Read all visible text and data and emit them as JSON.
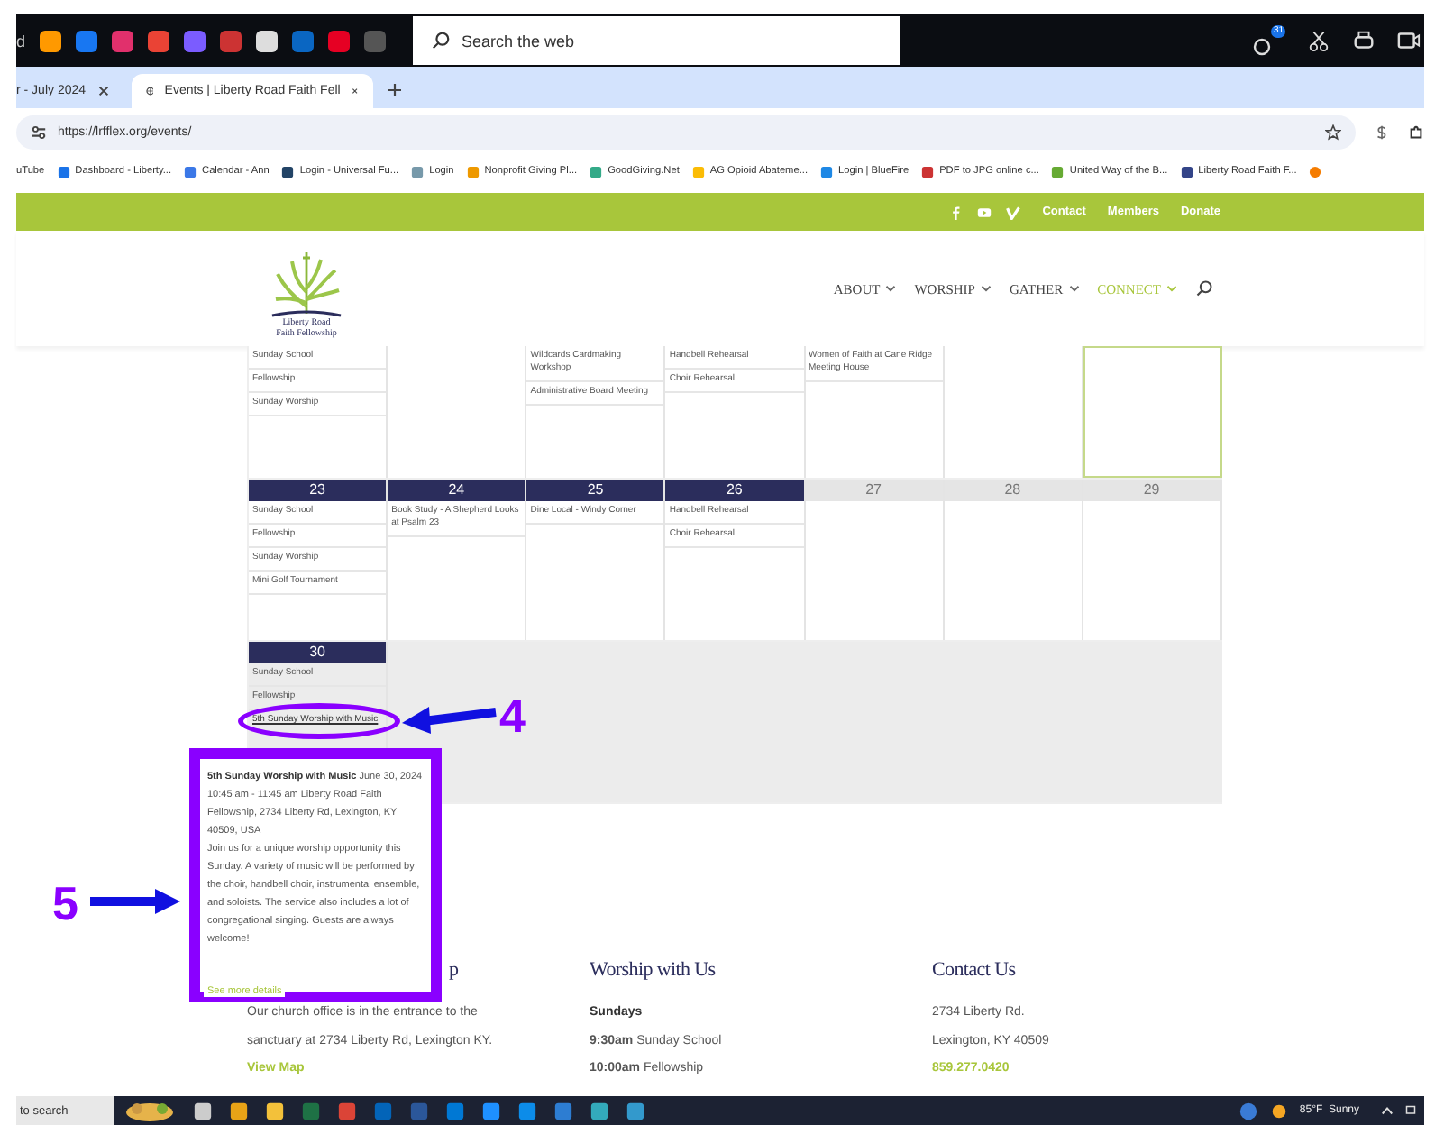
{
  "top_bar": {
    "left_fragment": "d",
    "search_placeholder": "Search the web",
    "notification_count": "31"
  },
  "tabs": [
    {
      "label": "r - July 2024",
      "selected": false
    },
    {
      "label": "Events | Liberty Road Faith Fell",
      "selected": true
    }
  ],
  "address_bar": {
    "url": "https://lrfflex.org/events/"
  },
  "bookmarks": [
    "uTube",
    "Dashboard - Liberty...",
    "Calendar - Ann",
    "Login - Universal Fu...",
    "Login",
    "Nonprofit Giving Pl...",
    "GoodGiving.Net",
    "AG Opioid Abateme...",
    "Login | BlueFire",
    "PDF to JPG online c...",
    "United Way of the B...",
    "Liberty Road Faith F..."
  ],
  "site_top_links": [
    "Contact",
    "Members",
    "Donate"
  ],
  "logo_text": [
    "Liberty Road",
    "Faith Fellowship"
  ],
  "nav": [
    {
      "label": "ABOUT",
      "selected": false
    },
    {
      "label": "WORSHIP",
      "selected": false
    },
    {
      "label": "GATHER",
      "selected": false
    },
    {
      "label": "CONNECT",
      "selected": true
    }
  ],
  "calendar": {
    "weeks": [
      {
        "days": [
          {
            "today": false,
            "events": [
              {
                "title": "Sunday School",
                "kind": "event"
              },
              {
                "title": "Fellowship",
                "kind": "event"
              },
              {
                "title": "Sunday Worship",
                "kind": "event"
              }
            ]
          },
          {
            "today": false
          },
          {
            "today": false,
            "events": [
              {
                "title": "Wildcards Cardmaking Workshop",
                "kind": "event"
              },
              {
                "title": "Administrative Board Meeting",
                "kind": "event"
              }
            ]
          },
          {
            "today": false,
            "events": [
              {
                "title": "Handbell Rehearsal",
                "kind": "event"
              },
              {
                "title": "Choir Rehearsal",
                "kind": "event"
              }
            ]
          },
          {
            "today": false,
            "events": [
              {
                "title": "Women of Faith at Cane Ridge Meeting House",
                "kind": "event"
              }
            ]
          },
          {
            "today": false
          },
          {
            "today": true
          }
        ]
      },
      {
        "days": [
          {
            "number": "23",
            "active": true,
            "events": [
              {
                "title": "Sunday School",
                "kind": "event"
              },
              {
                "title": "Fellowship",
                "kind": "event"
              },
              {
                "title": "Sunday Worship",
                "kind": "event"
              },
              {
                "title": "Mini Golf Tournament",
                "kind": "event"
              }
            ]
          },
          {
            "number": "24",
            "active": true,
            "events": [
              {
                "title": "Book Study - A Shepherd Looks at Psalm 23",
                "kind": "event"
              }
            ]
          },
          {
            "number": "25",
            "active": true,
            "events": [
              {
                "title": "Dine Local - Windy Corner",
                "kind": "event"
              }
            ]
          },
          {
            "number": "26",
            "active": true,
            "events": [
              {
                "title": "Handbell Rehearsal",
                "kind": "event"
              },
              {
                "title": "Choir Rehearsal",
                "kind": "event"
              }
            ]
          },
          {
            "number": "27",
            "active": false
          },
          {
            "number": "28",
            "active": false
          },
          {
            "number": "29",
            "active": false
          }
        ]
      },
      {
        "days": [
          {
            "number": "30",
            "active": true,
            "past": true,
            "events": [
              {
                "title": "Sunday School",
                "kind": "event"
              },
              {
                "title": "Fellowship",
                "kind": "event"
              },
              {
                "title": "5th Sunday Worship with Music",
                "kind": "link"
              }
            ]
          }
        ]
      }
    ]
  },
  "event_popup": {
    "details": "**5th Sunday Worship with Music** June 30, 2024  10:45 am - 11:45 am Liberty Road Faith Fellowship, 2734 Liberty Rd, Lexington, KY 40509, USA",
    "description": "Join us for a unique worship opportunity this Sunday.  A variety of music will be performed by the choir, handbell choir, instrumental ensemble, and soloists.  The service also includes a lot of congregational singing.  Guests are always welcome!",
    "link": "See more details"
  },
  "annotations": [
    {
      "label": "4"
    },
    {
      "label": "5"
    }
  ],
  "footer": [
    {
      "heading": "p",
      "lines": [
        {
          "kind": "text",
          "text": "Our church office is in the entrance to the sanctuary at 2734 Liberty Rd, Lexington KY."
        },
        {
          "kind": "link",
          "text": "View Map"
        }
      ]
    },
    {
      "heading": "Worship with Us",
      "lines": [
        {
          "kind": "bold",
          "text": "Sundays"
        },
        {
          "kind": "text",
          "text": "**9:30am** Sunday School"
        },
        {
          "kind": "text",
          "text": "**10:00am** Fellowship"
        }
      ]
    },
    {
      "heading": "Contact Us",
      "lines": [
        {
          "kind": "text",
          "text": "2734 Liberty Rd."
        },
        {
          "kind": "text",
          "text": "Lexington, KY 40509"
        },
        {
          "kind": "link",
          "text": "859.277.0420"
        }
      ]
    }
  ],
  "taskbar": {
    "search_text": "to search",
    "weather": "85°F  Sunny"
  }
}
